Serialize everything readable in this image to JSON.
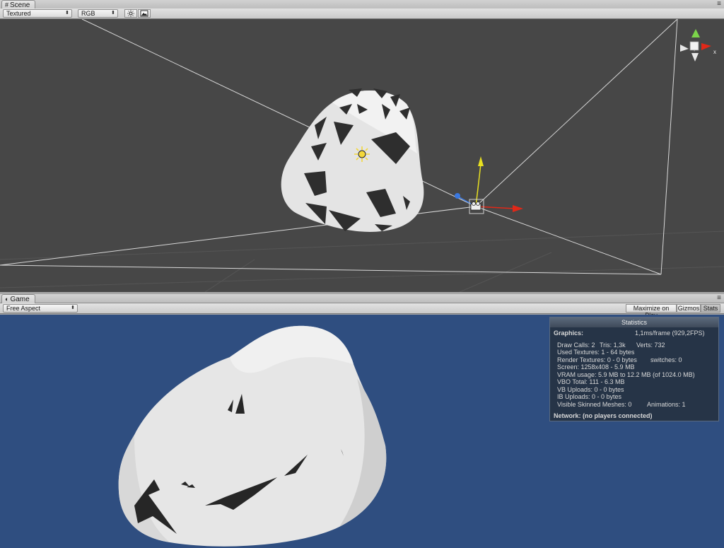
{
  "scene_panel": {
    "tab_icon": "#",
    "tab_label": "Scene",
    "menu_icon": "≡",
    "render_mode": "Textured",
    "channel": "RGB",
    "lighting_icon": "sun-toggle-icon",
    "image_icon": "image-toggle-icon",
    "gizmo_axis_label": "x"
  },
  "game_panel": {
    "tab_icon": "◐",
    "tab_label": "Game",
    "menu_icon": "≡",
    "aspect": "Free Aspect",
    "maximize_on_play": "Maximize on Play",
    "gizmos": "Gizmos",
    "stats": "Stats"
  },
  "statistics": {
    "title": "Statistics",
    "graphics_label": "Graphics:",
    "frame_time": "1,1ms/frame (929,2FPS)",
    "draw_calls": "Draw Calls: 2",
    "tris": "Tris: 1,3k",
    "verts": "Verts: 732",
    "used_textures": "Used Textures: 1 - 64 bytes",
    "render_textures": "Render Textures: 0 - 0 bytes",
    "switches": "switches: 0",
    "screen": "Screen: 1258x408 - 5.9 MB",
    "vram": "VRAM usage: 5.9 MB to 12.2 MB (of 1024.0 MB)",
    "vbo": "VBO Total: 111 - 6.3 MB",
    "vb_uploads": "VB Uploads: 0 - 0 bytes",
    "ib_uploads": "IB Uploads: 0 - 0 bytes",
    "skinned": "Visible Skinned Meshes: 0",
    "animations": "Animations: 1",
    "network": "Network: (no players connected)"
  },
  "colors": {
    "scene_bg": "#474747",
    "game_bg": "#2f4e80",
    "gizmo_y": "#e8e020",
    "gizmo_x": "#e02818",
    "gizmo_z": "#3a78e0"
  }
}
